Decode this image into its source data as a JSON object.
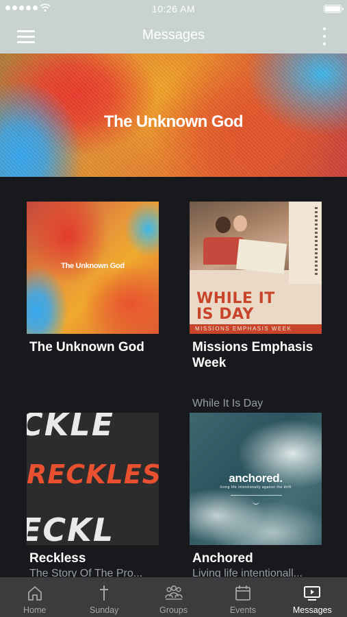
{
  "status_bar": {
    "time": "10:26 AM"
  },
  "nav": {
    "title": "Messages"
  },
  "hero": {
    "title": "The Unknown God"
  },
  "series": [
    {
      "title": "The Unknown God",
      "subtitle": "",
      "art_label": "The Unknown God"
    },
    {
      "title": "Missions Emphasis Week",
      "subtitle": "While It Is Day",
      "art_headline_1": "WHILE IT",
      "art_headline_2": "IS DAY",
      "art_band": "MISSIONS EMPHASIS WEEK"
    },
    {
      "title": "Reckless",
      "subtitle": "The Story Of The Pro...",
      "art_top": "CKLE",
      "art_middle": "RECKLESS",
      "art_bottom": "ECKL"
    },
    {
      "title": "Anchored",
      "subtitle": "Living life intentionall...",
      "art_label": "anchored.",
      "art_sub": "living life intentionally against the drift"
    }
  ],
  "tabs": [
    {
      "label": "Home",
      "icon": "home-icon",
      "active": false
    },
    {
      "label": "Sunday",
      "icon": "cross-icon",
      "active": false
    },
    {
      "label": "Groups",
      "icon": "groups-icon",
      "active": false
    },
    {
      "label": "Events",
      "icon": "calendar-icon",
      "active": false
    },
    {
      "label": "Messages",
      "icon": "tv-play-icon",
      "active": true
    }
  ],
  "colors": {
    "header_bg": "#c8d3d1",
    "content_bg": "#17191c",
    "tabbar_bg": "#3a3c3e",
    "tab_inactive": "#a5a7a9",
    "tab_active": "#ffffff",
    "subtitle": "#9a9ea2"
  }
}
